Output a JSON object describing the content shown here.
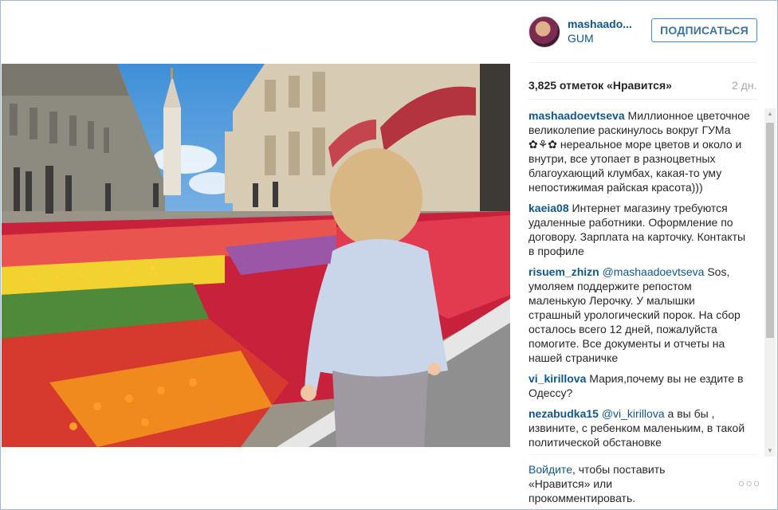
{
  "post": {
    "username": "mashaado...",
    "location": "GUM",
    "follow_label": "ПОДПИСАТЬСЯ",
    "likes": "3,825 отметок «Нравится»",
    "time": "2 дн."
  },
  "comments": [
    {
      "author": "mashaadoevtseva",
      "mention": "",
      "text": "Миллионное цветочное великолепие раскинулось вокруг ГУМа ✿⚘✿ нереальное море цветов и около и внутри, все утопает в разноцветных благоухающий клумбах, какая-то уму непостижимая райская красота)))"
    },
    {
      "author": "kaeia08",
      "mention": "",
      "text": "Интернет магазину требуются удаленные работники. Оформление по договору. Зарплата на карточку. Контакты в профиле"
    },
    {
      "author": "risuem_zhizn",
      "mention": "@mashaadoevtseva",
      "text": "Sos, умоляем поддержите репостом маленькую Лерочку. У малышки страшный урологический порок. На сбор осталось всего 12 дней, пожалуйста помогите. Все документы и отчеты на нашей страничке"
    },
    {
      "author": "vi_kirillova",
      "mention": "",
      "text": "Мария,почему вы не ездите в Одессу?"
    },
    {
      "author": "nezabudka15",
      "mention": "@vi_kirillova",
      "text": "а вы бы , извините, с ребенком маленьким, в такой политической обстановке"
    }
  ],
  "footer": {
    "login_link": "Войдите",
    "login_text": ", чтобы поставить «Нравится» или прокомментировать.",
    "more": "○○○"
  },
  "scroll": {
    "up": "▲",
    "down": "▼"
  },
  "colors": {
    "link": "#125688",
    "button_border": "#3f8bd1",
    "text": "#262626",
    "muted": "#a5a7aa"
  },
  "icons": {
    "more": "more-options-icon"
  }
}
